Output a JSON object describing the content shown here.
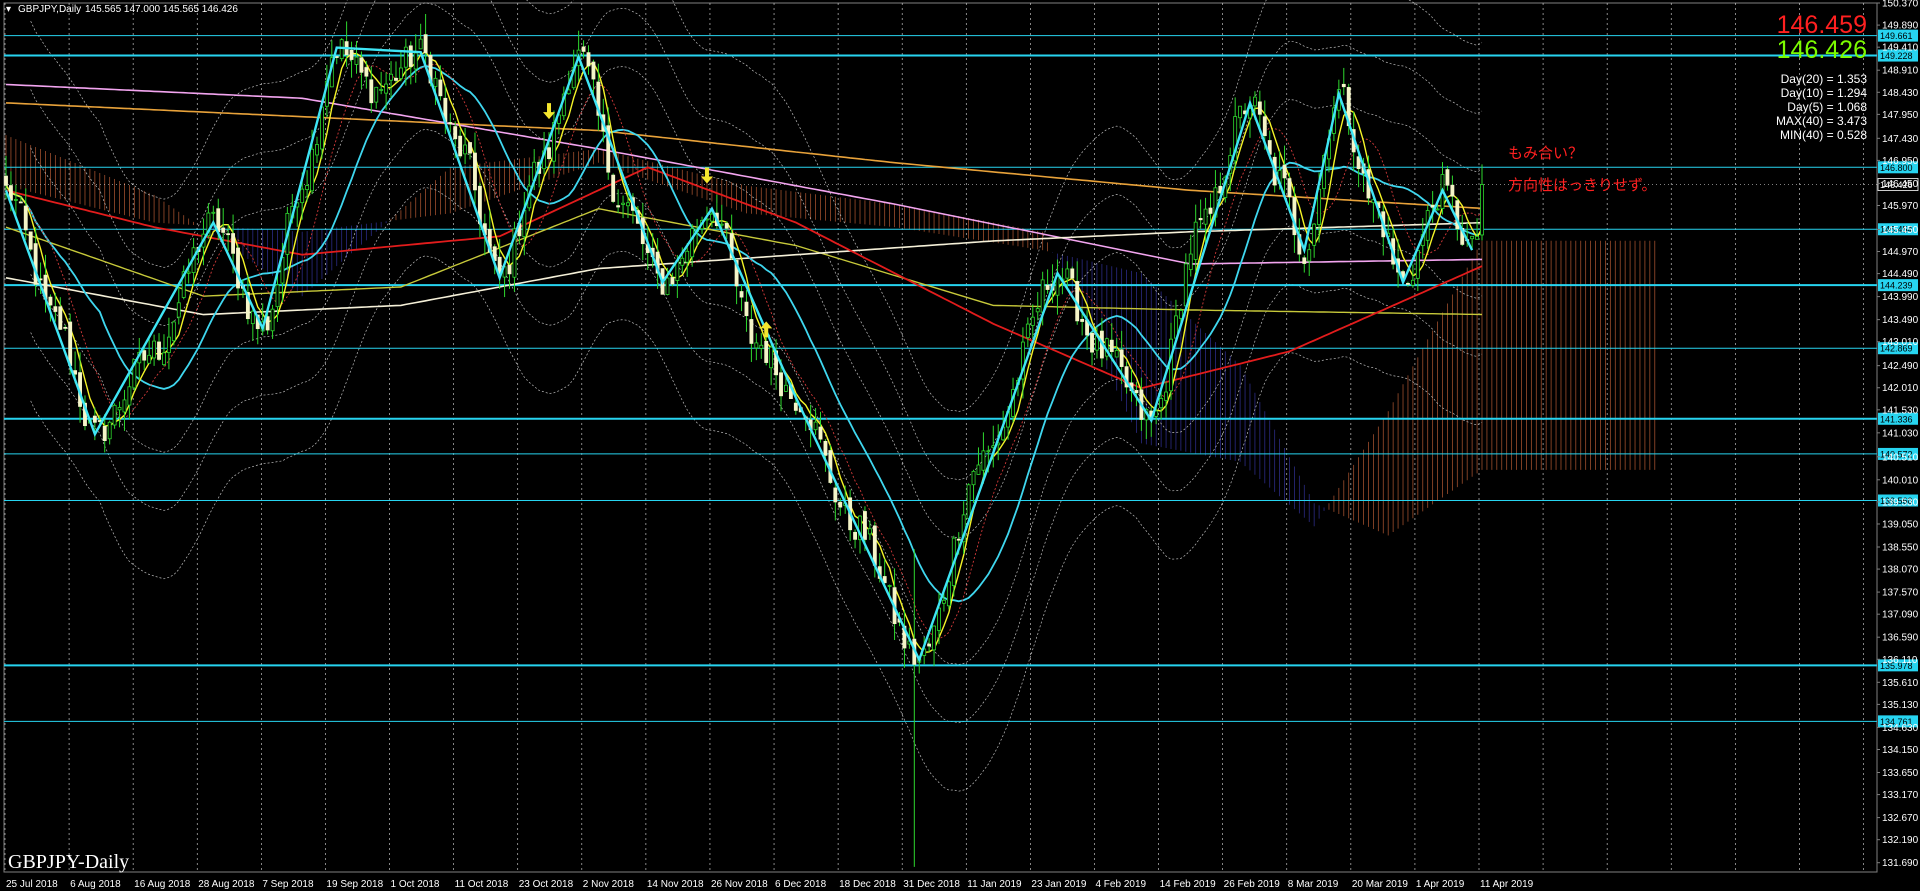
{
  "header": {
    "symbol": "GBPJPY,Daily",
    "ohlc": "145.565 147.000 145.565 146.426"
  },
  "watermark": "GBPJPY-Daily",
  "prices": {
    "bid": "146.459",
    "ask": "146.426",
    "bid_color": "#ff2020",
    "ask_color": "#7cfc00"
  },
  "stats": [
    "Day(20) = 1.353",
    "Day(10) = 1.294",
    "Day(5) = 1.068",
    "MAX(40) = 3.473",
    "MIN(40) = 0.528"
  ],
  "annotations": {
    "line1": "もみ合い？",
    "line2": "方向性はっきりせず。"
  },
  "chart_data": {
    "type": "candlestick",
    "ylim": [
      131.488,
      150.37
    ],
    "y_ticks": [
      "150.370",
      "149.890",
      "149.410",
      "148.910",
      "148.430",
      "147.950",
      "147.430",
      "146.950",
      "146.450",
      "145.970",
      "145.450",
      "144.970",
      "144.490",
      "143.990",
      "143.490",
      "143.010",
      "142.490",
      "142.010",
      "141.530",
      "141.030",
      "140.510",
      "140.010",
      "139.530",
      "139.050",
      "138.550",
      "138.070",
      "137.570",
      "137.090",
      "136.590",
      "136.110",
      "135.610",
      "135.130",
      "134.630",
      "134.150",
      "133.650",
      "133.170",
      "132.670",
      "132.190",
      "131.690"
    ],
    "x_labels": [
      "25 Jul 2018",
      "6 Aug 2018",
      "16 Aug 2018",
      "28 Aug 2018",
      "7 Sep 2018",
      "19 Sep 2018",
      "1 Oct 2018",
      "11 Oct 2018",
      "23 Oct 2018",
      "2 Nov 2018",
      "14 Nov 2018",
      "26 Nov 2018",
      "6 Dec 2018",
      "18 Dec 2018",
      "31 Dec 2018",
      "11 Jan 2019",
      "23 Jan 2019",
      "4 Feb 2019",
      "14 Feb 2019",
      "26 Feb 2019",
      "8 Mar 2019",
      "20 Mar 2019",
      "1 Apr 2019",
      "11 Apr 2019"
    ],
    "horizontal_lines": [
      {
        "price": 149.661,
        "label": "149.661",
        "width": 1
      },
      {
        "price": 149.228,
        "label": "149.228",
        "width": 2
      },
      {
        "price": 146.8,
        "label": "146.800",
        "width": 1
      },
      {
        "price": 145.454,
        "label": "145.454",
        "width": 1
      },
      {
        "price": 144.239,
        "label": "144.239",
        "width": 2
      },
      {
        "price": 142.869,
        "label": "142.869",
        "width": 1
      },
      {
        "price": 141.336,
        "label": "141.336",
        "width": 2
      },
      {
        "price": 140.572,
        "label": "140.572",
        "width": 1
      },
      {
        "price": 139.56,
        "label": "139.560",
        "width": 1
      },
      {
        "price": 135.978,
        "label": "135.978",
        "width": 2
      },
      {
        "price": 134.761,
        "label": "134.761",
        "width": 1
      }
    ],
    "current_price": {
      "price": 146.426,
      "label": "146.426"
    },
    "zigzag": [
      [
        0,
        146.3
      ],
      [
        18,
        141.0
      ],
      [
        42,
        145.6
      ],
      [
        52,
        143.3
      ],
      [
        67,
        149.4
      ],
      [
        84,
        149.3
      ],
      [
        100,
        144.4
      ],
      [
        116,
        149.2
      ],
      [
        133,
        144.3
      ],
      [
        143,
        145.9
      ],
      [
        160,
        141.8
      ],
      [
        185,
        136.1
      ],
      [
        213,
        144.5
      ],
      [
        232,
        141.3
      ],
      [
        252,
        148.2
      ],
      [
        263,
        145.0
      ],
      [
        270,
        148.4
      ],
      [
        283,
        144.3
      ],
      [
        291,
        146.3
      ],
      [
        297,
        145.0
      ]
    ],
    "key_prices": [
      [
        0,
        146.3
      ],
      [
        10,
        143.5
      ],
      [
        18,
        141.0
      ],
      [
        30,
        142.8
      ],
      [
        42,
        145.6
      ],
      [
        52,
        143.3
      ],
      [
        60,
        146.5
      ],
      [
        67,
        149.4
      ],
      [
        75,
        148.5
      ],
      [
        84,
        149.3
      ],
      [
        92,
        147.2
      ],
      [
        100,
        144.4
      ],
      [
        108,
        146.8
      ],
      [
        116,
        149.2
      ],
      [
        125,
        146.0
      ],
      [
        133,
        144.3
      ],
      [
        143,
        145.9
      ],
      [
        152,
        143.0
      ],
      [
        160,
        141.8
      ],
      [
        172,
        139.0
      ],
      [
        185,
        136.1
      ],
      [
        198,
        140.5
      ],
      [
        213,
        144.5
      ],
      [
        222,
        142.8
      ],
      [
        232,
        141.3
      ],
      [
        242,
        145.5
      ],
      [
        252,
        148.2
      ],
      [
        258,
        146.5
      ],
      [
        263,
        145.0
      ],
      [
        270,
        148.4
      ],
      [
        277,
        146.0
      ],
      [
        283,
        144.3
      ],
      [
        291,
        146.3
      ],
      [
        297,
        145.0
      ],
      [
        300,
        146.4
      ]
    ],
    "candle_count": 300
  }
}
